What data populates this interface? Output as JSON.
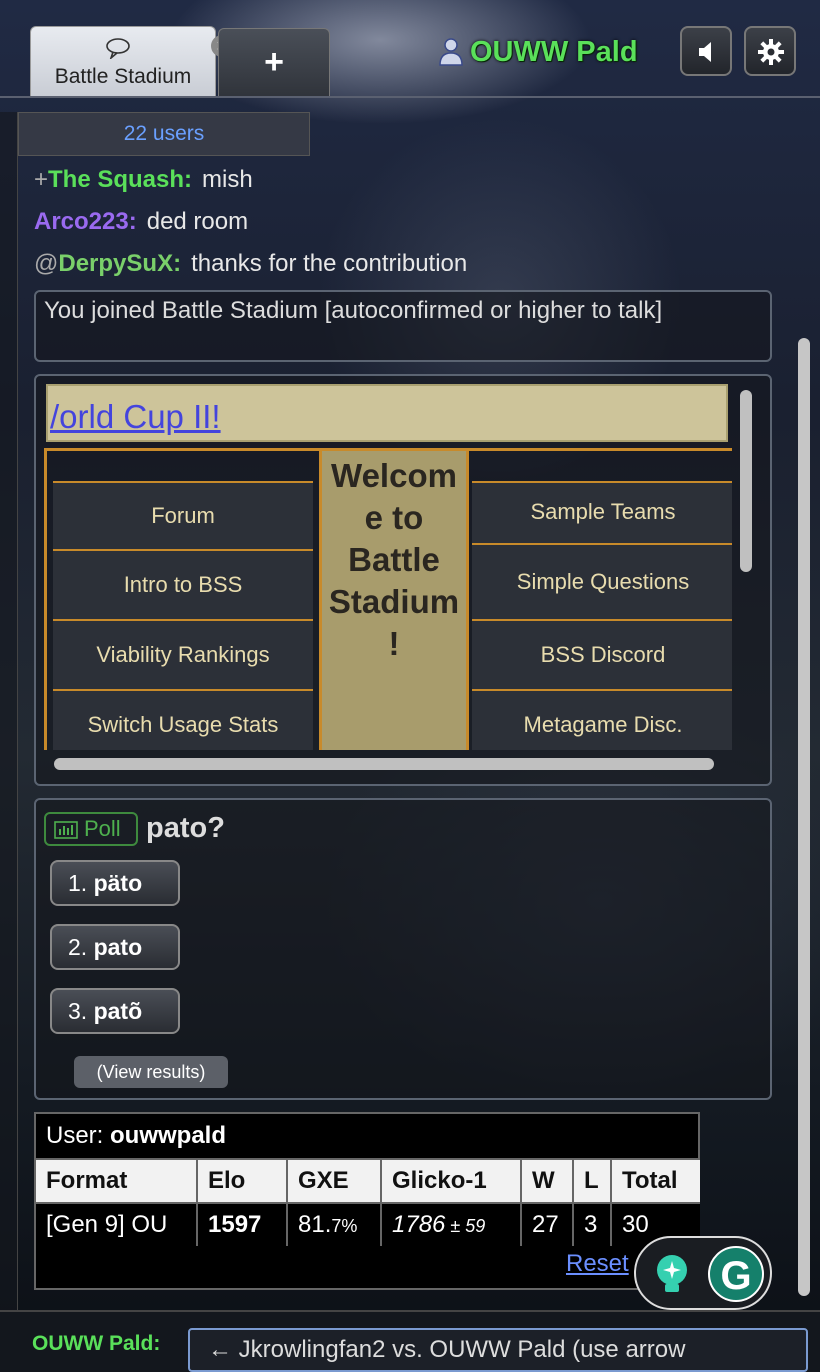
{
  "header": {
    "tab": {
      "label": "Battle Stadium"
    },
    "new_tab_label": "+",
    "user_name": "OUWW Pald"
  },
  "userlist": {
    "label": "22 users"
  },
  "chat": [
    {
      "rank": "+",
      "user": "The Squash:",
      "message": "mish",
      "color": "#5ae05a"
    },
    {
      "rank": "",
      "user": "Arco223:",
      "message": "ded room",
      "color": "#9a6af0"
    },
    {
      "rank": "@",
      "user": "DerpySuX:",
      "message": "thanks for the contribution",
      "color": "#7ad06a"
    }
  ],
  "notice": "You joined Battle Stadium [autoconfirmed or higher to talk]",
  "infobox": {
    "marquee": "/orld Cup II!",
    "welcome": "Welcom e to Battle Stadium !",
    "left_links": [
      "Forum",
      "Intro to BSS",
      "Viability Rankings",
      "Switch Usage Stats"
    ],
    "right_links": [
      "Sample Teams",
      "Simple Questions",
      "BSS Discord",
      "Metagame Disc."
    ]
  },
  "poll": {
    "badge": "Poll",
    "question": "pato?",
    "options": [
      {
        "num": "1.",
        "text": "päto"
      },
      {
        "num": "2.",
        "text": "pato"
      },
      {
        "num": "3.",
        "text": "patõ"
      }
    ],
    "view_results": "(View results)"
  },
  "ratings": {
    "user_label": "User:",
    "user": "ouwwpald",
    "headers": [
      "Format",
      "Elo",
      "GXE",
      "Glicko-1",
      "W",
      "L",
      "Total"
    ],
    "row": {
      "format": "[Gen 9] OU",
      "elo": "1597",
      "gxe_main": "81.",
      "gxe_small": "7%",
      "glicko_main": "1786",
      "glicko_dev": " ± 59",
      "w": "27",
      "l": "3",
      "total": "30"
    },
    "reset": "Reset"
  },
  "footer": {
    "name": "OUWW Pald:",
    "input_value": "← Jkrowlingfan2 vs. OUWW Pald (use arrow"
  }
}
